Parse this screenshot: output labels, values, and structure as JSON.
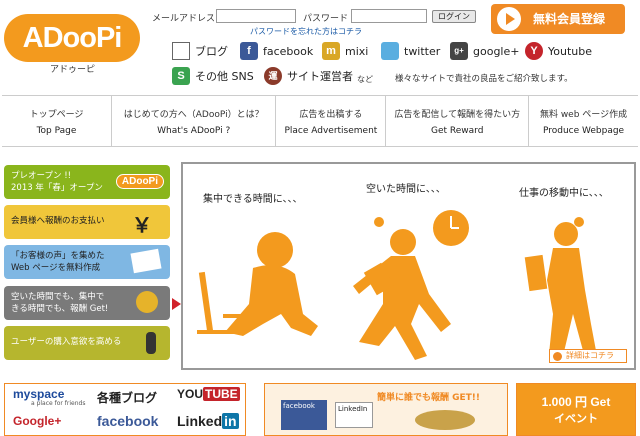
{
  "logo": {
    "text": "ADooPi",
    "sub": "アドゥーピ"
  },
  "login": {
    "email_label": "メールアドレス",
    "password_label": "パスワード",
    "button": "ログイン",
    "forgot": "パスワードを忘れた方はコチラ"
  },
  "register": {
    "label": "無料会員登録"
  },
  "sns": {
    "blog": "ブログ",
    "facebook": "facebook",
    "mixi": "mixi",
    "twitter": "twitter",
    "googleplus": "google+",
    "youtube": "Youtube",
    "other": "その他 SNS",
    "operator": "サイト運営者",
    "etc": "など",
    "tagline": "様々なサイトで貴社の良品をご紹介致します。",
    "ico": {
      "f": "f",
      "m": "m",
      "g": "g+",
      "y": "Y",
      "s": "S",
      "op": "運"
    }
  },
  "nav": [
    {
      "ja": "トップページ",
      "en": "Top Page"
    },
    {
      "ja": "はじめての方へ（ADooPi）とは？",
      "en": "What's ADooPi ?"
    },
    {
      "ja": "広告を出稿する",
      "en": "Place Advertisement"
    },
    {
      "ja": "広告を配信して報酬を得たい方",
      "en": "Get Reward"
    },
    {
      "ja": "無料 web ページ作成",
      "en": "Produce Webpage"
    }
  ],
  "side": {
    "preopen_1": "プレオープン !!",
    "preopen_2": "2013 年「春」オープン",
    "preopen_logo": "ADooPi",
    "reward": "会員様へ報酬のお支払い",
    "yen": "￥",
    "voice_1": "「お客様の声」を集めた",
    "voice_2": "Web ページを無料作成",
    "free_1": "空いた時間でも、集中で",
    "free_2": "きる時間でも、報酬 Get!",
    "buy": "ユーザーの購入意欲を高める"
  },
  "hero": {
    "cap1": "集中できる時間に、、、",
    "cap2": "空いた時間に、、、",
    "cap3": "仕事の移動中に、、、",
    "more": "詳細はコチラ"
  },
  "banners": {
    "myspace": "myspace",
    "myspace_sub": "a place for friends",
    "kakushu": "各種",
    "blog": "ブログ",
    "youtube_a": "YOU",
    "youtube_b": "TUBE",
    "google": "Google+",
    "facebook": "facebook",
    "linkedin_a": "Linked",
    "linkedin_b": "in",
    "get": "簡単に誰でも報酬 GET!!",
    "fb_small": "facebook",
    "li_small": "LinkedIn",
    "event_1": "1.000 円 Get",
    "event_2": "イベント"
  },
  "colors": {
    "orange": "#f39a1e",
    "green": "#8ab51c",
    "yellow": "#f0c63a",
    "blue": "#7fb7e3",
    "gray": "#7a7a7a",
    "olive": "#b6b62e"
  }
}
